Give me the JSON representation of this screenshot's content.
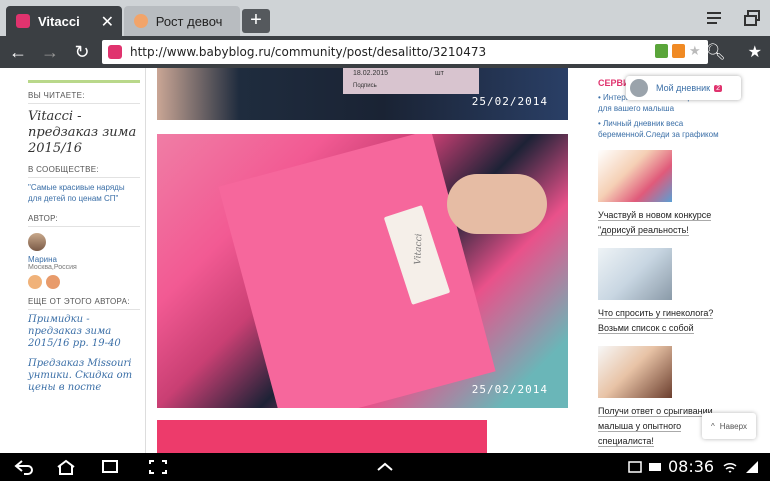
{
  "browser": {
    "tabs": [
      {
        "title": "Vitacci",
        "active": true
      },
      {
        "title": "Рост девоч",
        "active": false
      }
    ],
    "new_tab": "+",
    "url": "http://www.babyblog.ru/community/post/desalitto/3210473"
  },
  "left": {
    "reading_label": "ВЫ ЧИТАЕТЕ:",
    "post_title": "Vitacci - предзаказ зима 2015/16",
    "community_label": "В СООБЩЕСТВЕ:",
    "community_link": "\"Самые красивые наряды для детей по ценам СП\"",
    "author_label": "АВТОР:",
    "author_name": "Марина",
    "author_location": "Москва,Россия",
    "more_label": "ЕЩЕ ОТ ЭТОГО АВТОРА:",
    "more_links": [
      "Примидки - предзаказ зима 2015/16 рр. 19-40",
      "Предзаказ Missouri унтики. Скидка от цены в посте"
    ]
  },
  "photos": {
    "stamp_1": "25/02/2014",
    "stamp_2": "25/02/2014",
    "tag_date": "18.02.2015",
    "tag_unit": "шт",
    "tag_sign": "Подпись",
    "label_brand": "Vitacci"
  },
  "right": {
    "services_label": "СЕРВИ",
    "popup_text": "Мой дневник",
    "popup_badge": "2",
    "service_links": [
      "• Интерактивный план прививок для вашего малыша",
      "• Личный дневник веса беременной.Следи за графиком"
    ],
    "promos": [
      "Участвуй в новом конкурсе \"дорисуй реальность!",
      "Что спросить у гинеколога? Возьми список с собой",
      "Получи ответ о срыгивании малыша у опытного специалиста!"
    ],
    "back_to_top": "Наверх"
  },
  "system": {
    "time": "08:36"
  },
  "colors": {
    "brand": "#e0336e",
    "link": "#3b6fa7",
    "chrome": "#3b3f43"
  }
}
